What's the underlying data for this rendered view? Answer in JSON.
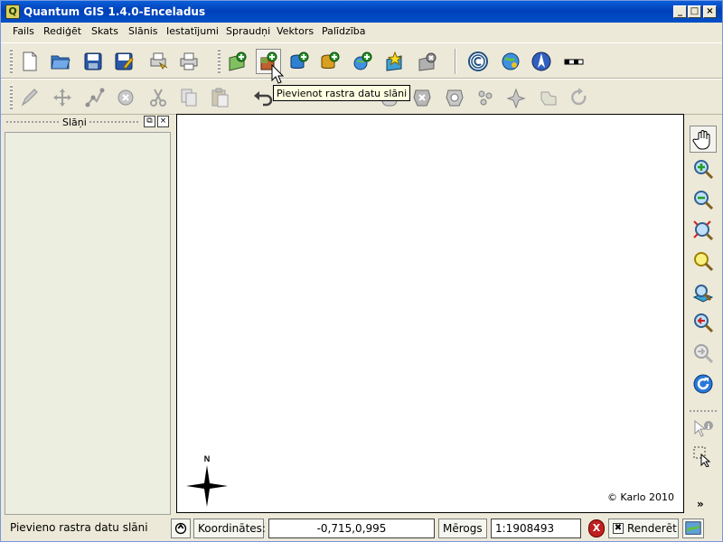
{
  "window": {
    "title": "Quantum GIS 1.4.0-Enceladus",
    "app_icon_letter": "Q",
    "minimize": "_",
    "maximize": "□",
    "close": "×"
  },
  "menu": [
    "Fails",
    "Rediģēt",
    "Skats",
    "Slānis",
    "Iestatījumi",
    "Spraudņi",
    "Vektors",
    "Palīdzība"
  ],
  "toolbar1": {
    "icons": [
      "new-project-icon",
      "open-project-icon",
      "save-project-icon",
      "save-as-icon",
      "print-composer-icon",
      "print-icon",
      "add-vector-layer-icon",
      "add-raster-layer-icon",
      "add-postgis-layer-icon",
      "add-spatialite-layer-icon",
      "add-wms-layer-icon",
      "new-vector-layer-icon",
      "remove-layer-icon",
      "copyright-label-icon",
      "georeferencer-icon",
      "north-arrow-icon",
      "scale-bar-icon"
    ]
  },
  "toolbar2": {
    "icons": [
      "toggle-editing-icon",
      "move-feature-icon",
      "node-tool-icon",
      "delete-selected-icon",
      "cut-features-icon",
      "copy-features-icon",
      "paste-features-icon",
      "undo-icon",
      "redo-icon",
      "add-ring-icon",
      "add-island-icon",
      "delete-ring-icon",
      "delete-part-icon",
      "reshape-features-icon",
      "split-features-icon",
      "merge-features-icon",
      "rotate-point-icon"
    ]
  },
  "tooltip": "Pievienot rastra datu slāni",
  "layers_panel": {
    "title": "Slāņi",
    "float_btn": "⧉",
    "close_btn": "×"
  },
  "map": {
    "copyright": "© Karlo 2010",
    "north_label": "N"
  },
  "map_navigation": {
    "icons": [
      "pan-icon",
      "zoom-in-icon",
      "zoom-out-icon",
      "zoom-full-icon",
      "zoom-to-selection-icon",
      "zoom-to-layer-icon",
      "zoom-last-icon",
      "zoom-next-icon",
      "refresh-icon",
      "identify-icon",
      "select-features-icon"
    ],
    "more": "»"
  },
  "status": {
    "message": "Pievieno rastra datu slāni",
    "coord_label": "Koordinātes:",
    "coord_value": "-0,715,0,995",
    "scale_label": "Mērogs",
    "scale_value": "1:1908493",
    "stop_label": "X",
    "render_label": "Renderēt",
    "render_checked": "✖"
  },
  "colors": {
    "title_bar": "#0050c8",
    "chrome": "#ece9d8",
    "layer_list_bg": "#ecefe0",
    "map_bg": "#ffffff",
    "tooltip_bg": "#ffffe1"
  }
}
